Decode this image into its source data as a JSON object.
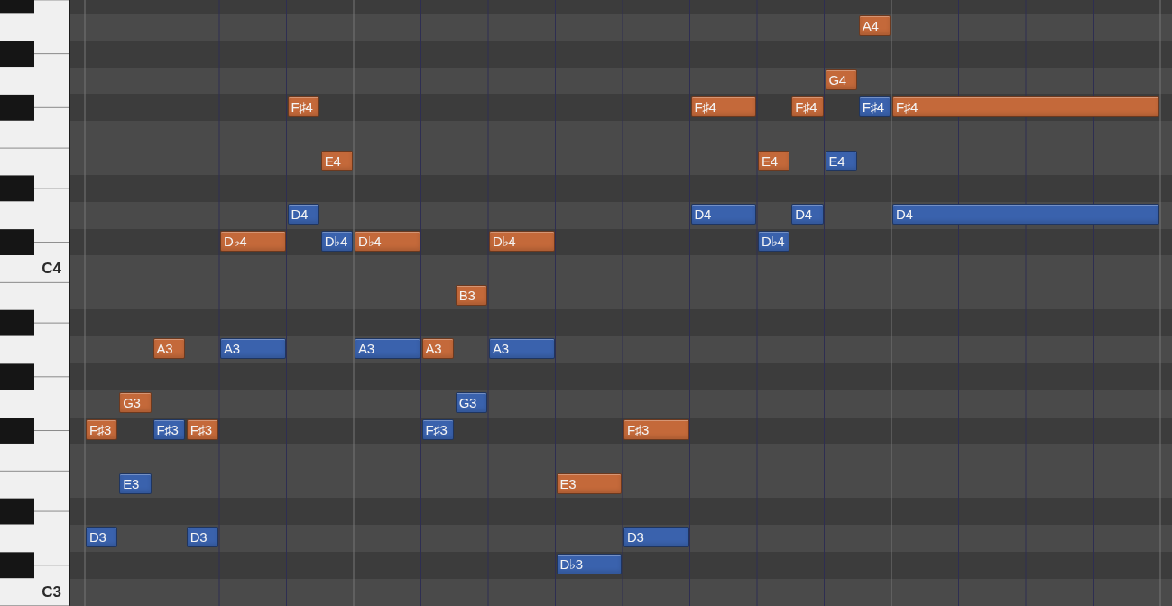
{
  "piano_roll": {
    "lanes": [
      {
        "kind": "black"
      },
      {
        "kind": "white",
        "events": [
          {
            "kind": "whole-rest"
          },
          {
            "kind": "whole-rest"
          },
          {
            "kind": "half-rest"
          },
          {
            "kind": "quarter-rest"
          },
          {
            "kind": "eighth-rest"
          },
          {
            "kind": "eighth",
            "label": "A4",
            "color": "#c4693a"
          }
        ]
      },
      {
        "kind": "black"
      },
      {
        "kind": "white",
        "events": [
          {
            "kind": "whole-rest"
          },
          {
            "kind": "whole-rest"
          },
          {
            "kind": "half-rest"
          },
          {
            "kind": "quarter-rest"
          },
          {
            "kind": "eighth",
            "label": "G4",
            "color": "#c4693a"
          }
        ]
      },
      {
        "kind": "black",
        "events": [
          {
            "kind": "half-rest"
          },
          {
            "kind": "quarter-rest"
          },
          {
            "kind": "eighth",
            "label": "F♯4",
            "color": "#c4693a"
          },
          {
            "kind": "whole-rest"
          },
          {
            "kind": "quarter-rest"
          },
          {
            "kind": "eighth-rest"
          },
          {
            "kind": "quarter",
            "label": "F♯4",
            "color": "#c4693a"
          },
          {
            "kind": "eighth-rest"
          },
          {
            "kind": "eighth",
            "label": "F♯4",
            "color": "#c4693a"
          },
          {
            "kind": "eighth-rest"
          },
          {
            "kind": "eighth",
            "label": "F♯4",
            "color": "#3a62ad"
          },
          {
            "kind": "whole",
            "label": "F♯4",
            "color": "#c4693a"
          }
        ]
      },
      {
        "kind": "white"
      },
      {
        "kind": "white",
        "events": [
          {
            "kind": "half-rest"
          },
          {
            "kind": "quarter-rest"
          },
          {
            "kind": "eighth-rest"
          },
          {
            "kind": "eighth",
            "label": "E4",
            "color": "#c4693a"
          },
          {
            "kind": "whole-rest"
          },
          {
            "kind": "half-rest"
          },
          {
            "kind": "eighth",
            "label": "E4",
            "color": "#c4693a"
          },
          {
            "kind": "eighth-rest"
          },
          {
            "kind": "eighth",
            "label": "E4",
            "color": "#3a62ad"
          }
        ]
      },
      {
        "kind": "black"
      },
      {
        "kind": "white",
        "events": [
          {
            "kind": "half-rest"
          },
          {
            "kind": "quarter-rest"
          },
          {
            "kind": "eighth",
            "label": "D4",
            "color": "#3a62ad"
          },
          {
            "kind": "whole-rest"
          },
          {
            "kind": "quarter-rest"
          },
          {
            "kind": "eighth-rest"
          },
          {
            "kind": "quarter",
            "label": "D4",
            "color": "#3a62ad"
          },
          {
            "kind": "eighth-rest"
          },
          {
            "kind": "eighth",
            "label": "D4",
            "color": "#3a62ad"
          },
          {
            "kind": "quarter-rest"
          },
          {
            "kind": "whole",
            "label": "D4",
            "color": "#3a62ad"
          }
        ]
      },
      {
        "kind": "black",
        "events": [
          {
            "kind": "half-rest"
          },
          {
            "kind": "quarter",
            "label": "D♭4",
            "color": "#c4693a"
          },
          {
            "kind": "eighth-rest"
          },
          {
            "kind": "eighth",
            "label": "D♭4",
            "color": "#3a62ad"
          },
          {
            "kind": "quarter",
            "label": "D♭4",
            "color": "#c4693a"
          },
          {
            "kind": "quarter-rest"
          },
          {
            "kind": "quarter",
            "label": "D♭4",
            "color": "#c4693a"
          },
          {
            "kind": "half-rest"
          },
          {
            "kind": "quarter-rest"
          },
          {
            "kind": "eighth",
            "label": "D♭4",
            "color": "#3a62ad"
          }
        ]
      },
      {
        "kind": "white",
        "label": "C4"
      },
      {
        "kind": "white",
        "events": [
          {
            "kind": "whole-rest"
          },
          {
            "kind": "quarter-rest"
          },
          {
            "kind": "eighth-rest"
          },
          {
            "kind": "eighth",
            "label": "B3",
            "color": "#c4693a"
          }
        ]
      },
      {
        "kind": "black"
      },
      {
        "kind": "white",
        "events": [
          {
            "kind": "quarter-rest"
          },
          {
            "kind": "eighth",
            "label": "A3",
            "color": "#c4693a"
          },
          {
            "kind": "eighth-rest"
          },
          {
            "kind": "quarter",
            "label": "A3",
            "color": "#3a62ad"
          },
          {
            "kind": "quarter-rest"
          },
          {
            "kind": "quarter",
            "label": "A3",
            "color": "#3a62ad"
          },
          {
            "kind": "eighth",
            "label": "A3",
            "color": "#c4693a"
          },
          {
            "kind": "eighth-rest"
          },
          {
            "kind": "quarter",
            "label": "A3",
            "color": "#3a62ad"
          }
        ]
      },
      {
        "kind": "black"
      },
      {
        "kind": "white",
        "events": [
          {
            "kind": "eighth-rest"
          },
          {
            "kind": "eighth",
            "label": "G3",
            "color": "#c4693a"
          },
          {
            "kind": "whole-rest"
          },
          {
            "kind": "eighth-rest"
          },
          {
            "kind": "eighth",
            "label": "G3",
            "color": "#3a62ad"
          }
        ]
      },
      {
        "kind": "black",
        "events": [
          {
            "kind": "eighth",
            "label": "F♯3",
            "color": "#c4693a"
          },
          {
            "kind": "eighth-rest"
          },
          {
            "kind": "eighth",
            "label": "F♯3",
            "color": "#3a62ad"
          },
          {
            "kind": "eighth",
            "label": "F♯3",
            "color": "#c4693a"
          },
          {
            "kind": "half-rest"
          },
          {
            "kind": "quarter-rest"
          },
          {
            "kind": "eighth",
            "label": "F♯3",
            "color": "#3a62ad"
          },
          {
            "kind": "half-rest"
          },
          {
            "kind": "eighth-rest"
          },
          {
            "kind": "quarter",
            "label": "F♯3",
            "color": "#c4693a"
          }
        ]
      },
      {
        "kind": "white"
      },
      {
        "kind": "white",
        "events": [
          {
            "kind": "eighth-rest"
          },
          {
            "kind": "eighth",
            "label": "E3",
            "color": "#3a62ad"
          },
          {
            "kind": "whole-rest"
          },
          {
            "kind": "half-rest"
          },
          {
            "kind": "quarter",
            "label": "E3",
            "color": "#c4693a"
          }
        ]
      },
      {
        "kind": "black"
      },
      {
        "kind": "white",
        "events": [
          {
            "kind": "eighth",
            "label": "D3",
            "color": "#3a62ad"
          },
          {
            "kind": "quarter-rest"
          },
          {
            "kind": "eighth",
            "label": "D3",
            "color": "#3a62ad"
          },
          {
            "kind": "whole-rest"
          },
          {
            "kind": "half-rest"
          },
          {
            "kind": "quarter",
            "label": "D3",
            "color": "#3a62ad"
          }
        ]
      },
      {
        "kind": "black",
        "events": [
          {
            "kind": "whole-rest"
          },
          {
            "kind": "half-rest"
          },
          {
            "kind": "quarter-rest"
          },
          {
            "kind": "quarter",
            "label": "D♭3",
            "color": "#3a62ad"
          }
        ]
      },
      {
        "kind": "white",
        "label": "C3"
      }
    ]
  }
}
